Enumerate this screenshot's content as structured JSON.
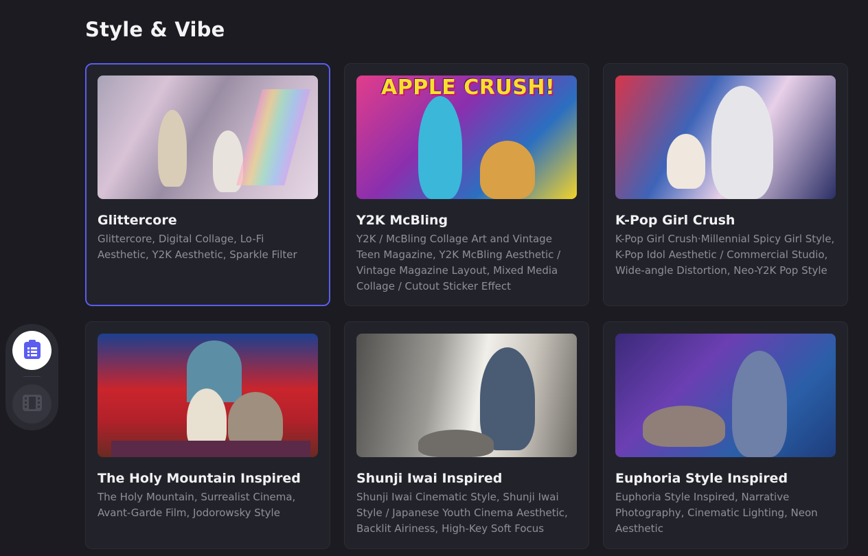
{
  "page": {
    "title": "Style & Vibe"
  },
  "cards": [
    {
      "title": "Glittercore",
      "description": "Glittercore, Digital Collage, Lo-Fi Aesthetic, Y2K Aesthetic, Sparkle Filter",
      "selected": true,
      "thumbnail_text": ""
    },
    {
      "title": "Y2K McBling",
      "description": "Y2K / McBling Collage Art and Vintage Teen Magazine, Y2K McBling Aesthetic / Vintage Magazine Layout, Mixed Media Collage / Cutout Sticker Effect",
      "selected": false,
      "thumbnail_text": "APPLE CRUSH!"
    },
    {
      "title": "K-Pop Girl Crush",
      "description": "K-Pop Girl Crush·Millennial Spicy Girl Style, K-Pop Idol Aesthetic / Commercial Studio, Wide-angle Distortion, Neo-Y2K Pop Style",
      "selected": false,
      "thumbnail_text": ""
    },
    {
      "title": "The Holy Mountain Inspired",
      "description": "The Holy Mountain, Surrealist Cinema, Avant-Garde Film, Jodorowsky Style",
      "selected": false,
      "thumbnail_text": ""
    },
    {
      "title": "Shunji Iwai Inspired",
      "description": "Shunji Iwai Cinematic Style, Shunji Iwai Style / Japanese Youth Cinema Aesthetic, Backlit Airiness, High-Key Soft Focus",
      "selected": false,
      "thumbnail_text": ""
    },
    {
      "title": "Euphoria Style Inspired",
      "description": "Euphoria Style Inspired, Narrative Photography, Cinematic Lighting, Neon Aesthetic",
      "selected": false,
      "thumbnail_text": ""
    }
  ],
  "side_dock": {
    "items": [
      {
        "icon": "list-clipboard-icon",
        "active": true
      },
      {
        "icon": "film-strip-icon",
        "active": false
      }
    ]
  },
  "colors": {
    "background": "#1b1b21",
    "card": "#22232a",
    "accent_selected": "#5b5cf0",
    "text_primary": "#f2f2f4",
    "text_secondary": "#8e8f98"
  }
}
